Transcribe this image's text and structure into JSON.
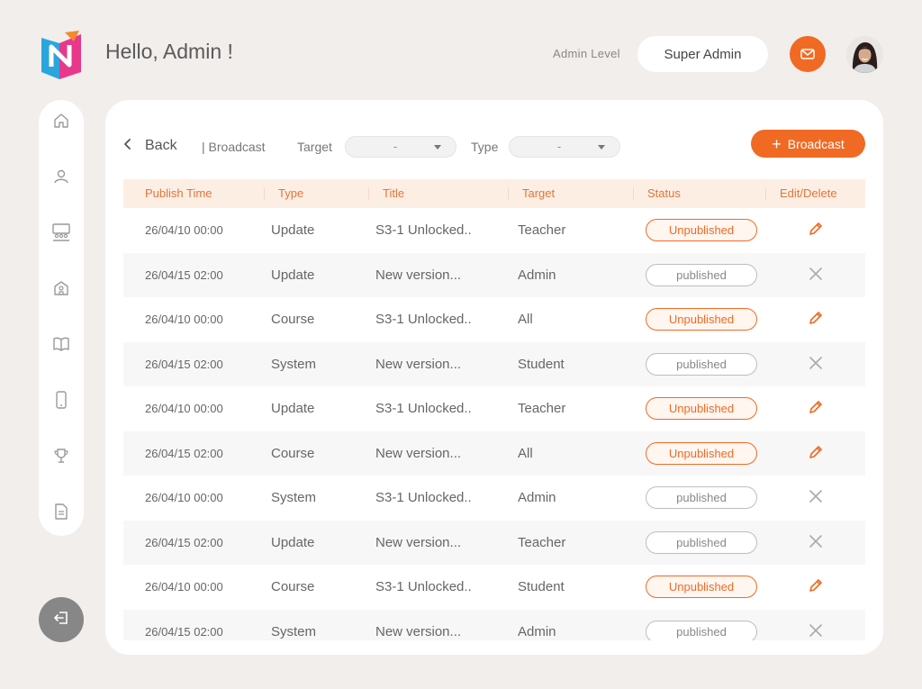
{
  "header": {
    "greeting": "Hello, Admin !",
    "admin_level_label": "Admin Level",
    "admin_level_value": "Super Admin"
  },
  "icons": {
    "logo": "app-logo",
    "mail": "mail-icon",
    "avatar": "user-avatar",
    "sidebar": [
      "home-icon",
      "user-icon",
      "classroom-icon",
      "school-icon",
      "book-icon",
      "tablet-icon",
      "trophy-icon",
      "document-icon"
    ],
    "logout": "logout-icon",
    "back": "chevron-left-icon",
    "edit": "pencil-icon",
    "delete": "close-icon"
  },
  "colors": {
    "accent": "#f06a24",
    "header_bg": "#fdeee4",
    "header_text": "#e0763a",
    "page_bg": "#f1eeeb"
  },
  "toolbar": {
    "back_label": "Back",
    "breadcrumb": "| Broadcast",
    "target_label": "Target",
    "target_value": "-",
    "type_label": "Type",
    "type_value": "-",
    "broadcast_button": "Broadcast"
  },
  "table": {
    "columns": [
      "Publish Time",
      "Type",
      "Title",
      "Target",
      "Status",
      "Edit/Delete"
    ],
    "rows": [
      {
        "time": "26/04/10 00:00",
        "type": "Update",
        "title": "S3-1 Unlocked..",
        "target": "Teacher",
        "status": "Unpublished"
      },
      {
        "time": "26/04/15 02:00",
        "type": "Update",
        "title": "New version...",
        "target": "Admin",
        "status": "published"
      },
      {
        "time": "26/04/10 00:00",
        "type": "Course",
        "title": "S3-1 Unlocked..",
        "target": "All",
        "status": "Unpublished"
      },
      {
        "time": "26/04/15 02:00",
        "type": "System",
        "title": "New version...",
        "target": "Student",
        "status": "published"
      },
      {
        "time": "26/04/10 00:00",
        "type": "Update",
        "title": "S3-1 Unlocked..",
        "target": "Teacher",
        "status": "Unpublished"
      },
      {
        "time": "26/04/15 02:00",
        "type": "Course",
        "title": "New version...",
        "target": "All",
        "status": "Unpublished"
      },
      {
        "time": "26/04/10 00:00",
        "type": "System",
        "title": "S3-1 Unlocked..",
        "target": "Admin",
        "status": "published"
      },
      {
        "time": "26/04/15 02:00",
        "type": "Update",
        "title": "New version...",
        "target": "Teacher",
        "status": "published"
      },
      {
        "time": "26/04/10 00:00",
        "type": "Course",
        "title": "S3-1 Unlocked..",
        "target": "Student",
        "status": "Unpublished"
      },
      {
        "time": "26/04/15 02:00",
        "type": "System",
        "title": "New version...",
        "target": "Admin",
        "status": "published"
      }
    ]
  }
}
